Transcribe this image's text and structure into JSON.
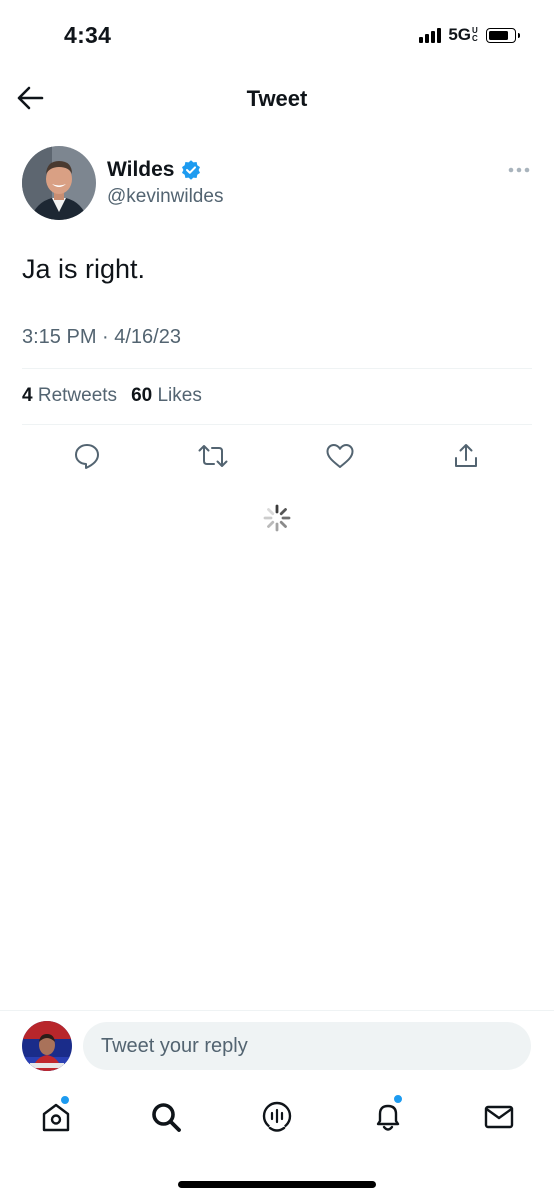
{
  "status_bar": {
    "time": "4:34",
    "network": "5G",
    "network_suffix": "UC",
    "icons": [
      "signal-icon",
      "battery-icon"
    ]
  },
  "header": {
    "title": "Tweet",
    "back_icon": "arrow-left-icon"
  },
  "tweet": {
    "author_name": "Wildes",
    "verified": true,
    "author_handle": "@kevinwildes",
    "text": "Ja is right.",
    "timestamp": "3:15 PM · 4/16/23",
    "retweets_count": "4",
    "retweets_label": "Retweets",
    "likes_count": "60",
    "likes_label": "Likes"
  },
  "actions": [
    "reply-icon",
    "retweet-icon",
    "like-icon",
    "share-icon"
  ],
  "reply": {
    "placeholder": "Tweet your reply"
  },
  "tabbar": {
    "items": [
      "home-icon",
      "search-icon",
      "spaces-icon",
      "notifications-icon",
      "messages-icon"
    ]
  },
  "colors": {
    "accent": "#1d9bf0",
    "secondary_text": "#536471",
    "divider": "#eff3f4"
  }
}
